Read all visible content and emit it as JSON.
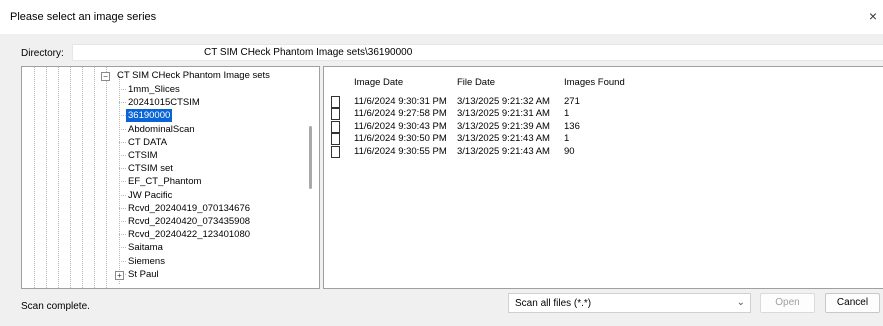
{
  "window": {
    "title": "Please select an image series",
    "close_glyph": "×"
  },
  "directory": {
    "label": "Directory:",
    "value": "CT SIM CHeck Phantom Image sets\\36190000"
  },
  "tree": {
    "root": {
      "label": "CT SIM CHeck Phantom Image sets",
      "expander": "−"
    },
    "items": [
      {
        "label": "1mm_Slices"
      },
      {
        "label": "20241015CTSIM"
      },
      {
        "label": "36190000",
        "selected": true
      },
      {
        "label": "AbdominalScan"
      },
      {
        "label": "CT DATA"
      },
      {
        "label": "CTSIM"
      },
      {
        "label": "CTSIM set"
      },
      {
        "label": "EF_CT_Phantom"
      },
      {
        "label": "JW Pacific"
      },
      {
        "label": "Rcvd_20240419_070134676"
      },
      {
        "label": "Rcvd_20240420_073435908"
      },
      {
        "label": "Rcvd_20240422_123401080"
      },
      {
        "label": "Saitama"
      },
      {
        "label": "Siemens"
      },
      {
        "label": "St Paul",
        "expander": "+"
      }
    ]
  },
  "list": {
    "columns": [
      "Image Date",
      "File Date",
      "Images Found"
    ],
    "rows": [
      {
        "image_date": "11/6/2024 9:30:31 PM",
        "file_date": "3/13/2025 9:21:32 AM",
        "images_found": "271"
      },
      {
        "image_date": "11/6/2024 9:27:58 PM",
        "file_date": "3/13/2025 9:21:31 AM",
        "images_found": "1"
      },
      {
        "image_date": "11/6/2024 9:30:43 PM",
        "file_date": "3/13/2025 9:21:39 AM",
        "images_found": "136"
      },
      {
        "image_date": "11/6/2024 9:30:50 PM",
        "file_date": "3/13/2025 9:21:43 AM",
        "images_found": "1"
      },
      {
        "image_date": "11/6/2024 9:30:55 PM",
        "file_date": "3/13/2025 9:21:43 AM",
        "images_found": "90"
      }
    ]
  },
  "footer": {
    "status": "Scan complete.",
    "filter": {
      "selected": "Scan all files (*.*)",
      "chevron": "⌄"
    },
    "open_label": "Open",
    "cancel_label": "Cancel"
  }
}
